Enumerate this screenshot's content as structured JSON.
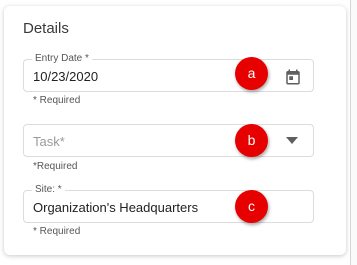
{
  "card": {
    "title": "Details"
  },
  "fields": {
    "entry_date": {
      "label": "Entry Date *",
      "value": "10/23/2020",
      "helper": "* Required"
    },
    "task": {
      "placeholder": "Task*",
      "helper": "*Required"
    },
    "site": {
      "label": "Site: *",
      "value": "Organization's Headquarters",
      "helper": "* Required"
    }
  },
  "annotations": {
    "a": "a",
    "b": "b",
    "c": "c",
    "color": "#e60000"
  },
  "icons": {
    "entry_date": "calendar-icon",
    "task": "dropdown-arrow-icon"
  }
}
